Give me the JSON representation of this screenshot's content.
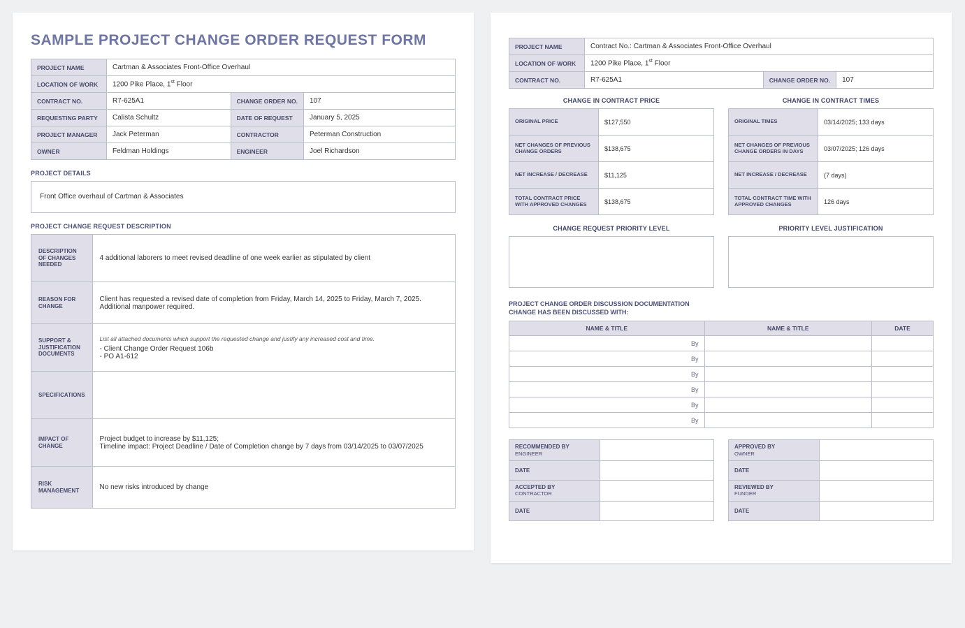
{
  "title": "SAMPLE PROJECT CHANGE ORDER REQUEST FORM",
  "header": {
    "project_name_lbl": "PROJECT NAME",
    "project_name": "Cartman & Associates Front-Office Overhaul",
    "location_lbl": "LOCATION OF WORK",
    "location": "1200 Pike Place, 1",
    "location_floor_sup": "st",
    "location_floor_after": " Floor",
    "contract_no_lbl": "CONTRACT NO.",
    "contract_no": "R7-625A1",
    "change_order_no_lbl": "CHANGE ORDER NO.",
    "change_order_no": "107",
    "requesting_party_lbl": "REQUESTING PARTY",
    "requesting_party": "Calista Schultz",
    "date_of_request_lbl": "DATE OF REQUEST",
    "date_of_request": "January 5, 2025",
    "project_manager_lbl": "PROJECT MANAGER",
    "project_manager": "Jack Peterman",
    "contractor_lbl": "CONTRACTOR",
    "contractor": "Peterman Construction",
    "owner_lbl": "OWNER",
    "owner": "Feldman Holdings",
    "engineer_lbl": "ENGINEER",
    "engineer": "Joel Richardson"
  },
  "details": {
    "heading": "PROJECT DETAILS",
    "text": "Front Office overhaul of Cartman & Associates"
  },
  "change_desc": {
    "heading": "PROJECT CHANGE REQUEST DESCRIPTION",
    "rows": {
      "descr_lbl": "DESCRIPTION OF CHANGES NEEDED",
      "descr": "4 additional laborers to meet revised deadline of one week earlier as stipulated by client",
      "reason_lbl": "REASON FOR CHANGE",
      "reason": "Client has requested a revised date of completion from Friday, March 14, 2025 to Friday, March 7, 2025.  Additional manpower required.",
      "support_lbl": "SUPPORT & JUSTIFICATION DOCUMENTS",
      "support_note": "List all attached documents which support the requested change and justify any increased cost and time.",
      "support_line1": "- Client Change Order Request 106b",
      "support_line2": "- PO A1-612",
      "spec_lbl": "SPECIFICATIONS",
      "spec": "",
      "impact_lbl": "IMPACT OF CHANGE",
      "impact": "Project budget to increase by $11,125;\nTimeline impact: Project Deadline / Date of Completion change by 7 days from 03/14/2025 to 03/07/2025",
      "risk_lbl": "RISK MANAGEMENT",
      "risk": "No new risks introduced by change"
    }
  },
  "page2": {
    "project_name": "Contract No.: Cartman & Associates Front-Office Overhaul",
    "location": "1200 Pike Place, 1",
    "contract_no": "R7-625A1",
    "change_order_no": "107"
  },
  "price": {
    "heading": "CHANGE IN CONTRACT PRICE",
    "original_lbl": "ORIGINAL PRICE",
    "original": "$127,550",
    "net_prev_lbl": "NET CHANGES OF PREVIOUS CHANGE ORDERS",
    "net_prev": "$138,675",
    "net_incdec_lbl": "NET INCREASE / DECREASE",
    "net_incdec": "$11,125",
    "total_lbl": "TOTAL CONTRACT PRICE WITH APPROVED CHANGES",
    "total": "$138,675"
  },
  "times": {
    "heading": "CHANGE IN CONTRACT TIMES",
    "original_lbl": "ORIGINAL TIMES",
    "original": "03/14/2025; 133 days",
    "net_prev_lbl": "NET CHANGES OF PREVIOUS CHANGE ORDERS IN DAYS",
    "net_prev": "03/07/2025; 126 days",
    "net_incdec_lbl": "NET INCREASE / DECREASE",
    "net_incdec": "(7 days)",
    "total_lbl": "TOTAL CONTRACT TIME WITH APPROVED CHANGES",
    "total": "126 days"
  },
  "priority": {
    "level_head": "CHANGE REQUEST PRIORITY LEVEL",
    "just_head": "PRIORITY LEVEL JUSTIFICATION"
  },
  "discuss": {
    "heading": "PROJECT CHANGE ORDER DISCUSSION DOCUMENTATION\nCHANGE HAS BEEN DISCUSSED WITH:",
    "col1": "NAME & TITLE",
    "col2": "NAME & TITLE",
    "col3": "DATE",
    "by": "By"
  },
  "sign": {
    "recommended": "RECOMMENDED BY",
    "engineer": "ENGINEER",
    "approved": "APPROVED BY",
    "owner": "OWNER",
    "accepted": "ACCEPTED BY",
    "contractor": "CONTRACTOR",
    "reviewed": "REVIEWED BY",
    "funder": "FUNDER",
    "date": "DATE"
  }
}
